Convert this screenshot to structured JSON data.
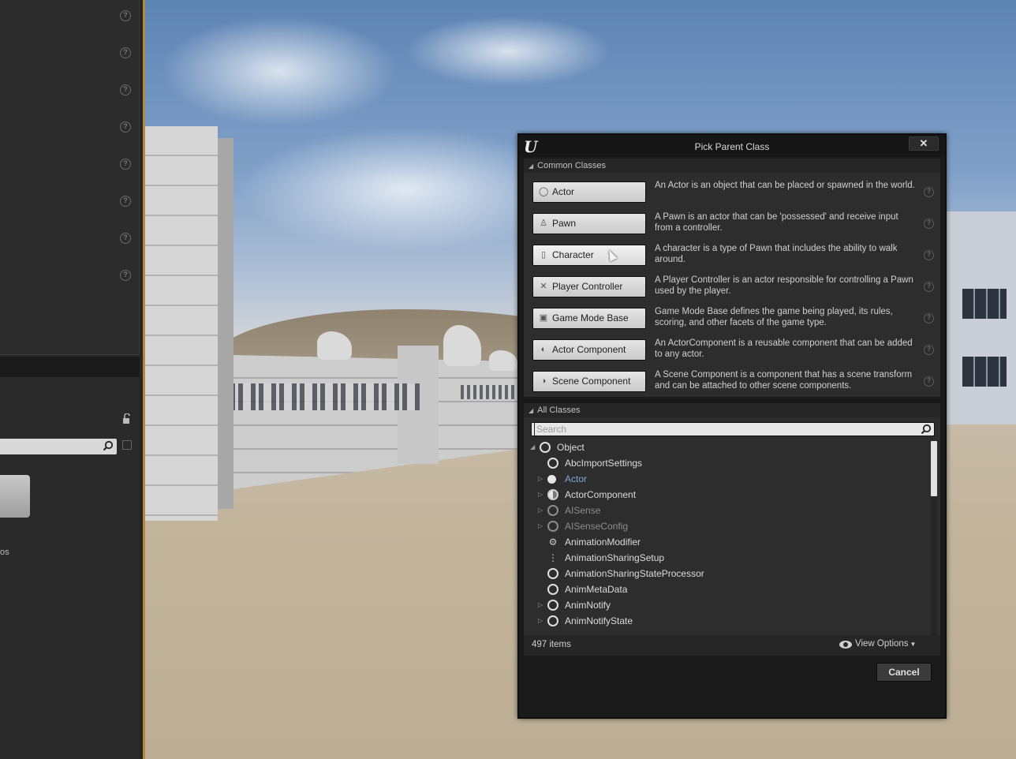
{
  "dialog": {
    "title": "Pick Parent Class",
    "close_label": "✕",
    "cancel_label": "Cancel"
  },
  "common_classes": {
    "header": "Common Classes",
    "items": [
      {
        "label": "Actor",
        "icon": "actor-icon",
        "description": "An Actor is an object that can be placed or spawned in the world."
      },
      {
        "label": "Pawn",
        "icon": "pawn-icon",
        "description": "A Pawn is an actor that can be 'possessed' and receive input from a controller."
      },
      {
        "label": "Character",
        "icon": "character-icon",
        "description": "A character is a type of Pawn that includes the ability to walk around."
      },
      {
        "label": "Player Controller",
        "icon": "player-controller-icon",
        "description": "A Player Controller is an actor responsible for controlling a Pawn used by the player."
      },
      {
        "label": "Game Mode Base",
        "icon": "game-mode-icon",
        "description": "Game Mode Base defines the game being played, its rules, scoring, and other facets of the game type."
      },
      {
        "label": "Actor Component",
        "icon": "actor-component-icon",
        "description": "An ActorComponent is a reusable component that can be added to any actor."
      },
      {
        "label": "Scene Component",
        "icon": "scene-component-icon",
        "description": "A Scene Component is a component that has a scene transform and can be attached to other scene components."
      }
    ]
  },
  "all_classes": {
    "header": "All Classes",
    "search_placeholder": "Search",
    "tree": [
      {
        "label": "Object",
        "depth": 0,
        "expander": "◢",
        "icon": "hollow",
        "style": "normal"
      },
      {
        "label": "AbcImportSettings",
        "depth": 1,
        "expander": "",
        "icon": "hollow",
        "style": "normal"
      },
      {
        "label": "Actor",
        "depth": 1,
        "expander": "▷",
        "icon": "filled",
        "style": "blue"
      },
      {
        "label": "ActorComponent",
        "depth": 1,
        "expander": "▷",
        "icon": "dual",
        "style": "normal"
      },
      {
        "label": "AISense",
        "depth": 1,
        "expander": "▷",
        "icon": "hollow",
        "style": "dim"
      },
      {
        "label": "AISenseConfig",
        "depth": 1,
        "expander": "▷",
        "icon": "hollow",
        "style": "dim"
      },
      {
        "label": "AnimationModifier",
        "depth": 1,
        "expander": "",
        "icon": "glyph-modifier",
        "style": "normal"
      },
      {
        "label": "AnimationSharingSetup",
        "depth": 1,
        "expander": "",
        "icon": "glyph-sharing",
        "style": "normal"
      },
      {
        "label": "AnimationSharingStateProcessor",
        "depth": 1,
        "expander": "",
        "icon": "hollow",
        "style": "normal"
      },
      {
        "label": "AnimMetaData",
        "depth": 1,
        "expander": "",
        "icon": "hollow",
        "style": "normal"
      },
      {
        "label": "AnimNotify",
        "depth": 1,
        "expander": "▷",
        "icon": "hollow",
        "style": "normal"
      },
      {
        "label": "AnimNotifyState",
        "depth": 1,
        "expander": "▷",
        "icon": "hollow",
        "style": "normal"
      }
    ],
    "item_count": "497 items",
    "view_options_label": "View Options"
  },
  "left_panel": {
    "partial_label": "os"
  }
}
